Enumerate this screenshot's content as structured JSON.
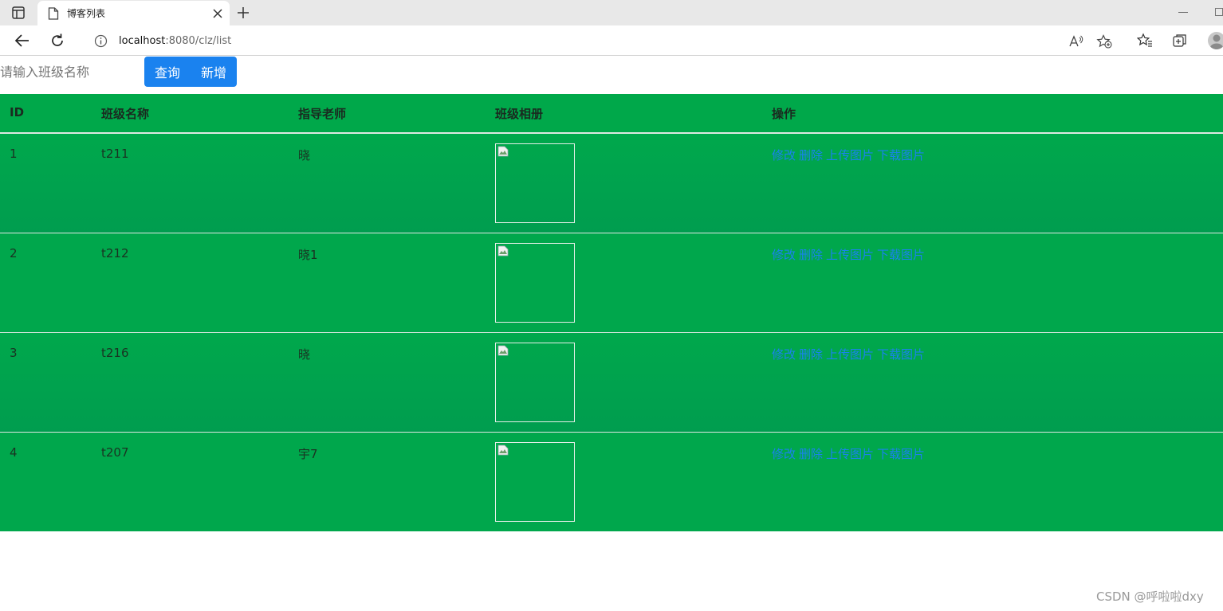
{
  "browser": {
    "tab_title": "博客列表",
    "url_host": "localhost",
    "url_rest": ":8080/clz/list"
  },
  "search": {
    "placeholder": "请输入班级名称",
    "query_label": "查询",
    "add_label": "新增"
  },
  "table": {
    "headers": [
      "ID",
      "班级名称",
      "指导老师",
      "班级相册",
      "操作"
    ],
    "rows": [
      {
        "id": "1",
        "name": "t211",
        "teacher": "晓"
      },
      {
        "id": "2",
        "name": "t212",
        "teacher": "晓1"
      },
      {
        "id": "3",
        "name": "t216",
        "teacher": "晓"
      },
      {
        "id": "4",
        "name": "t207",
        "teacher": "宇7"
      }
    ],
    "actions": {
      "edit": "修改",
      "delete": "删除",
      "upload": "上传图片",
      "download": "下载图片"
    }
  },
  "watermark": "CSDN @呼啦啦dxy"
}
